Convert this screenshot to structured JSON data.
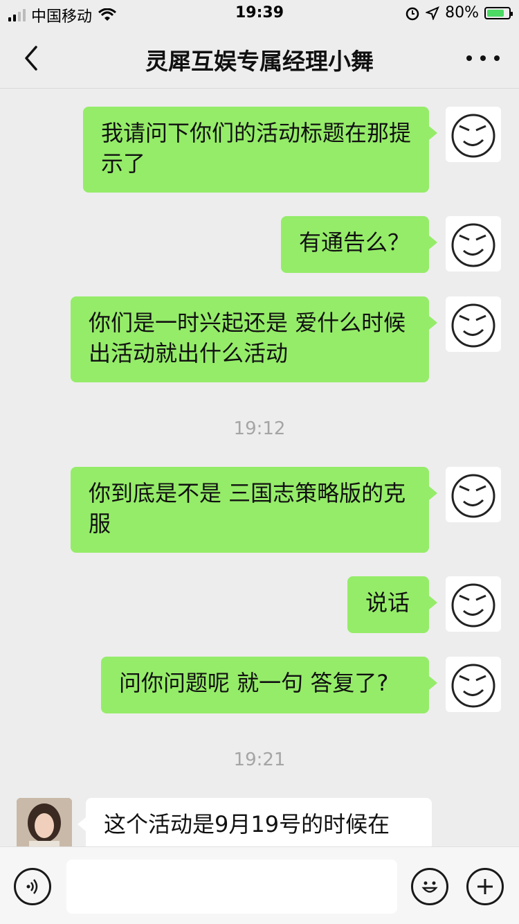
{
  "status_bar": {
    "carrier": "中国移动",
    "time": "19:39",
    "battery": "80%",
    "battery_level": 0.8
  },
  "header": {
    "title": "灵犀互娱专属经理小舞"
  },
  "messages": [
    {
      "sender": "me",
      "text": "我请问下你们的活动标题在那提示了"
    },
    {
      "sender": "me",
      "text": "有通告么？"
    },
    {
      "sender": "me",
      "text": "你们是一时兴起还是  爱什么时候出活动就出什么活动"
    },
    {
      "timestamp": "19:12"
    },
    {
      "sender": "me",
      "text": "你到底是不是  三国志策略版的克服"
    },
    {
      "sender": "me",
      "text": "说话"
    },
    {
      "sender": "me",
      "text": "问你问题呢 就一句 答复了?"
    },
    {
      "timestamp": "19:21"
    },
    {
      "sender": "them",
      "text": "这个活动是9月19号的时候在"
    }
  ],
  "icons": [
    "signal-icon",
    "wifi-icon",
    "alarm-icon",
    "location-icon",
    "battery-icon",
    "back-icon",
    "more-icon",
    "voice-icon",
    "emoji-icon",
    "plus-icon"
  ],
  "colors": {
    "my_bubble": "#95ec69",
    "their_bubble": "#ffffff",
    "background": "#ededed"
  }
}
